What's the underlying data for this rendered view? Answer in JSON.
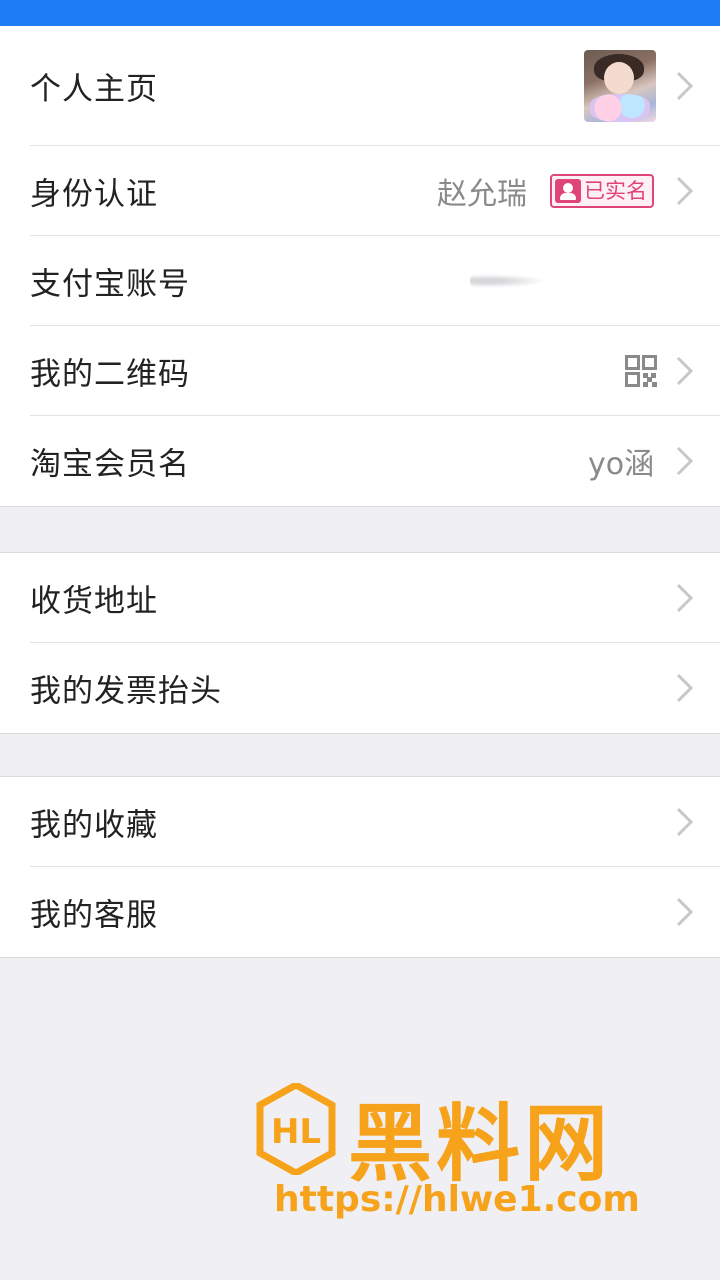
{
  "status_bar": {
    "color": "#1e7cf6"
  },
  "groups": [
    {
      "rows": [
        {
          "label": "个人主页",
          "right": "avatar"
        },
        {
          "label": "身份认证",
          "value": "赵允瑞",
          "badge": "已实名"
        },
        {
          "label": "支付宝账号"
        },
        {
          "label": "我的二维码",
          "right": "qr-code-icon"
        },
        {
          "label": "淘宝会员名",
          "value": "yo涵"
        }
      ]
    },
    {
      "rows": [
        {
          "label": "收货地址"
        },
        {
          "label": "我的发票抬头"
        }
      ]
    },
    {
      "rows": [
        {
          "label": "我的收藏"
        },
        {
          "label": "我的客服"
        }
      ]
    }
  ],
  "watermark": {
    "logo_text": "HL",
    "brand": "黑料网",
    "url": "https://hlwe1.com",
    "color": "#f6a21a"
  },
  "colors": {
    "accent": "#1e7cf6",
    "badge": "#e0457a",
    "background": "#f0f0f4"
  }
}
